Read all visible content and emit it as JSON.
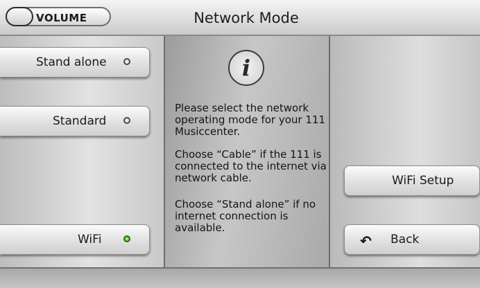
{
  "header": {
    "volume_label": "VOLUME",
    "title": "Network Mode"
  },
  "mode_options": [
    {
      "label": "Stand alone",
      "selected": false
    },
    {
      "label": "Standard",
      "selected": false
    },
    {
      "label": "WiFi",
      "selected": true
    }
  ],
  "info": {
    "icon": "info-icon",
    "icon_glyph": "i",
    "paragraphs": [
      "Please select the network operating mode for your 111 Musiccenter.",
      "Choose “Cable” if the 111 is connected to the internet via network cable.",
      "Choose “Stand alone” if no internet connection is available."
    ]
  },
  "right_buttons": {
    "wifi_setup_label": "WiFi Setup",
    "back_label": "Back",
    "back_icon": "back-arrow-icon"
  },
  "colors": {
    "led_active": "#6fcf2a",
    "led_inactive": "#e9e9e9"
  }
}
